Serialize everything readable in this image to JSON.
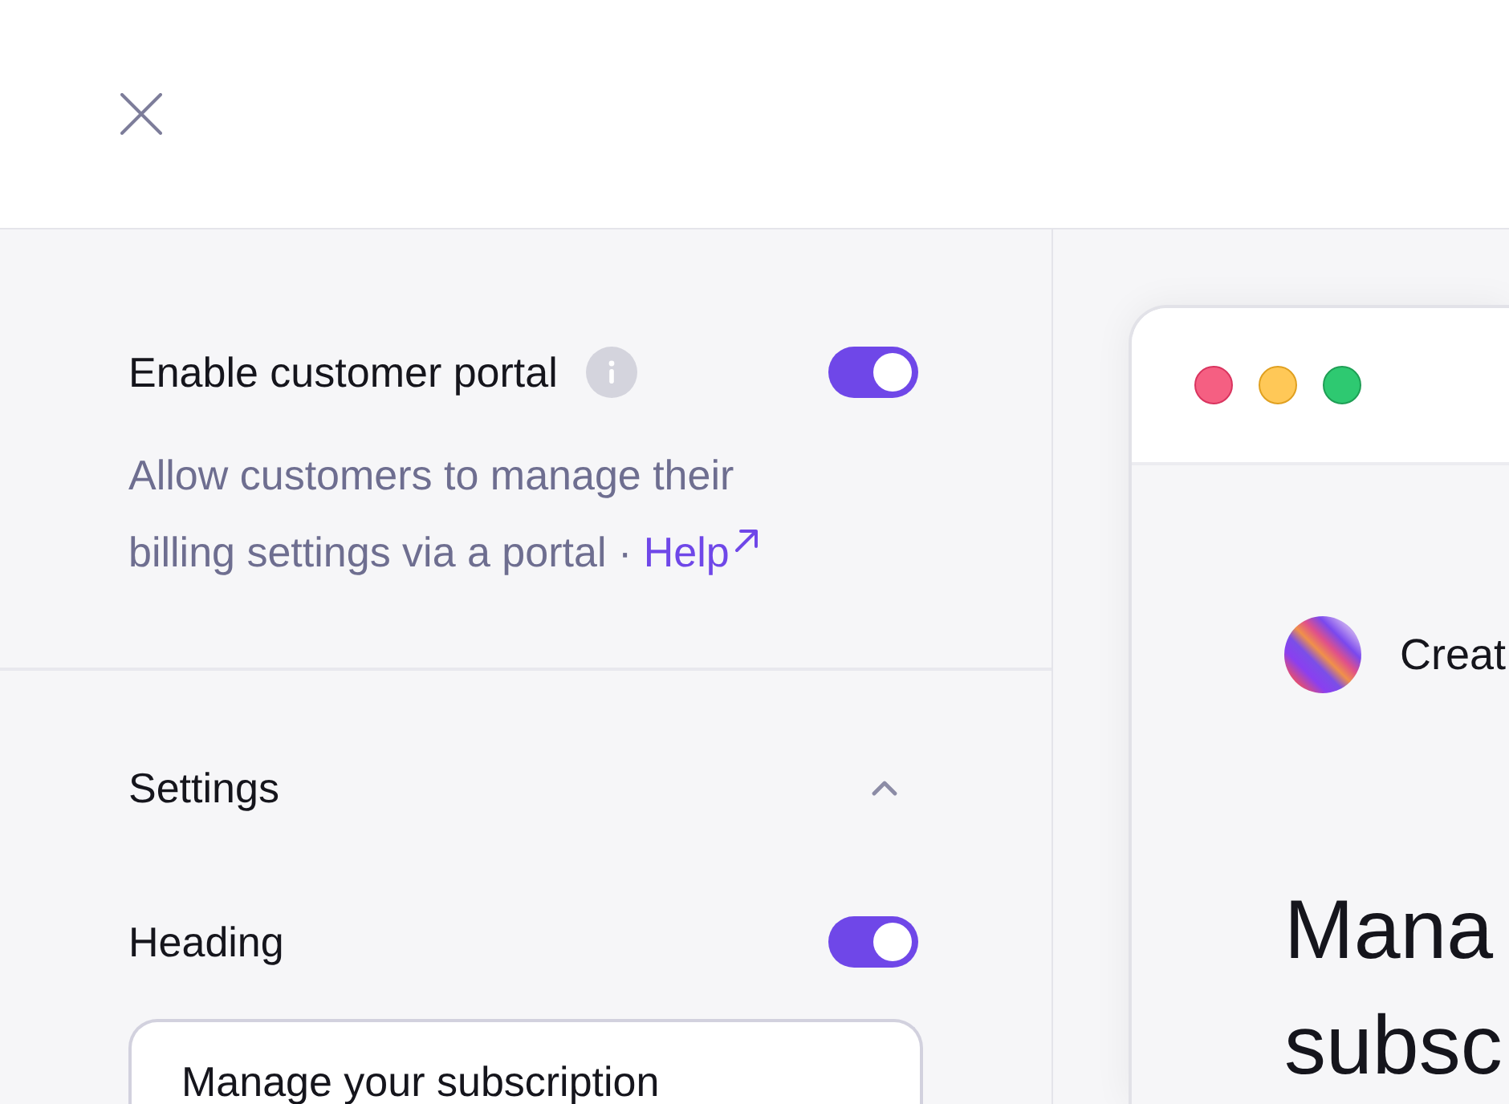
{
  "portal": {
    "title": "Enable customer portal",
    "enabled": true,
    "description": "Allow customers to manage their billing settings via a portal ·",
    "help_link": "Help"
  },
  "settings": {
    "title": "Settings",
    "expanded": true,
    "fields": [
      {
        "label": "Heading",
        "on": true,
        "value": "Manage your subscription"
      }
    ]
  },
  "preview": {
    "business_name": "Creat",
    "heading_lines": [
      "Mana",
      "subsc"
    ]
  }
}
